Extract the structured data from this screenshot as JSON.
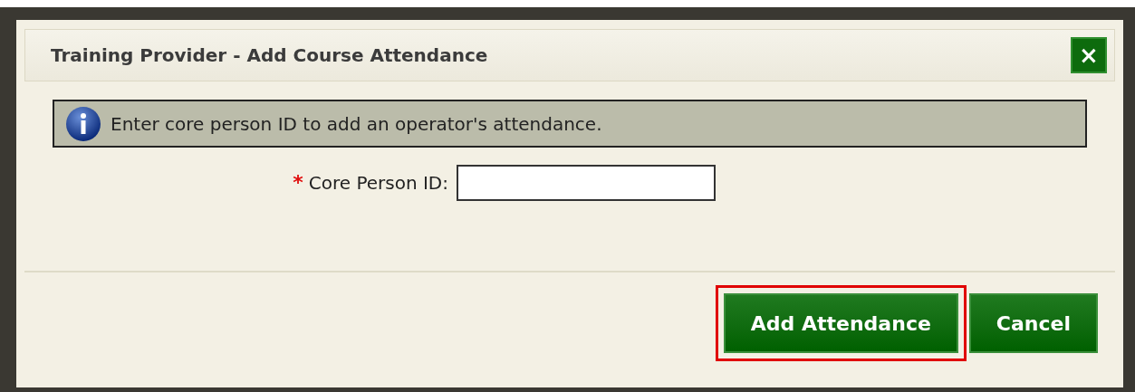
{
  "dialog": {
    "title": "Training Provider - Add Course Attendance",
    "close_label": "×"
  },
  "info": {
    "message": "Enter core person ID to add an operator's attendance."
  },
  "field": {
    "label": "Core Person ID:",
    "required": true,
    "required_mark": "*"
  },
  "buttons": [
    {
      "label": "Add Attendance",
      "highlighted": true
    },
    {
      "label": "Cancel",
      "highlighted": false
    }
  ]
}
